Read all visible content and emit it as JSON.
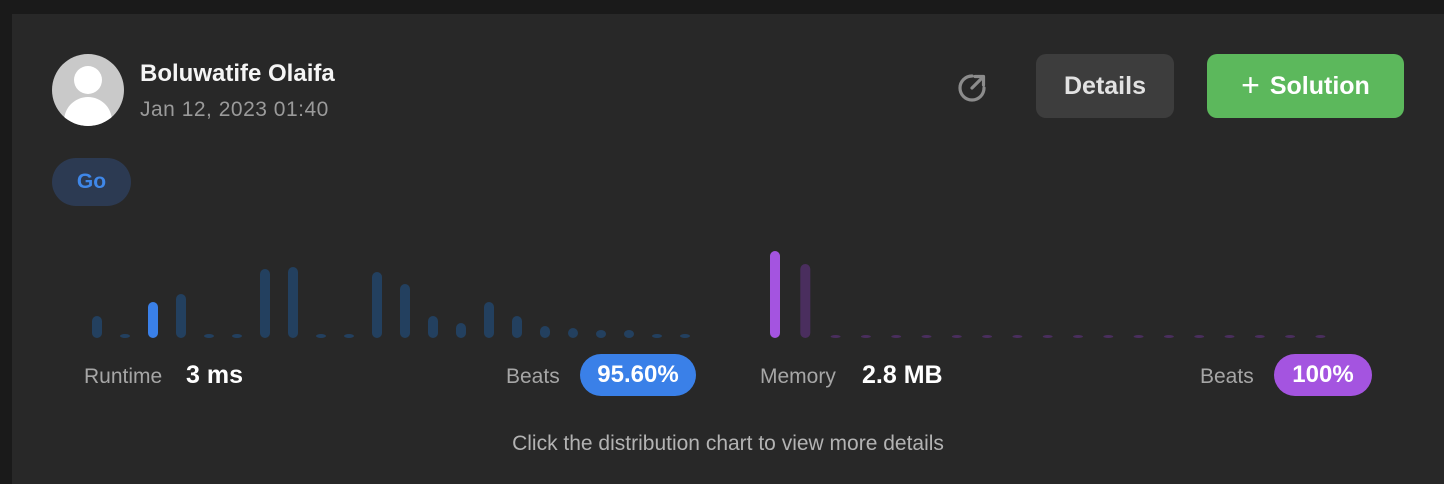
{
  "user": {
    "name": "Boluwatife Olaifa",
    "timestamp": "Jan 12, 2023 01:40"
  },
  "actions": {
    "share_icon": "share-arrow-icon",
    "details_label": "Details",
    "solution_label": "Solution",
    "solution_icon": "plus-icon"
  },
  "language": "Go",
  "runtime": {
    "label": "Runtime",
    "value": "3 ms",
    "beats_label": "Beats",
    "beats_value": "95.60%",
    "color": "#3a80e8",
    "bar_color": "#23405f",
    "highlight_index": 2,
    "bars": [
      22,
      4,
      36,
      44,
      4,
      4,
      69,
      71,
      4,
      4,
      66,
      54,
      22,
      15,
      36,
      22,
      12,
      10,
      8,
      8,
      4,
      4
    ]
  },
  "memory": {
    "label": "Memory",
    "value": "2.8 MB",
    "beats_label": "Beats",
    "beats_value": "100%",
    "color": "#a454e0",
    "bar_color": "#4a2e5e",
    "highlight_index": 0,
    "bars": [
      87,
      74,
      3,
      3,
      3,
      3,
      3,
      3,
      3,
      3,
      3,
      3,
      3,
      3,
      3,
      3,
      3,
      3,
      3
    ]
  },
  "hint": "Click the distribution chart to view more details"
}
